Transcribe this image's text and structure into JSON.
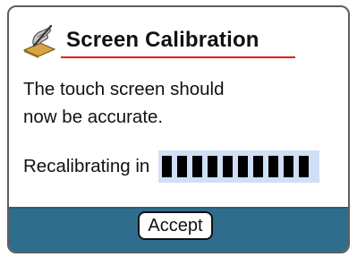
{
  "dialog": {
    "title": "Screen Calibration",
    "icon": "stylus-hand-icon",
    "message_line1": "The touch screen should",
    "message_line2": "now be accurate.",
    "countdown_label": "Recalibrating in",
    "progress": {
      "segments_filled": 10,
      "color": "#000000",
      "track_color": "#cfdff5"
    },
    "accept_label": "Accept"
  },
  "colors": {
    "accent_underline": "#e4201a",
    "footer_bar": "#2f6d8c",
    "border": "#5e5e5e"
  }
}
